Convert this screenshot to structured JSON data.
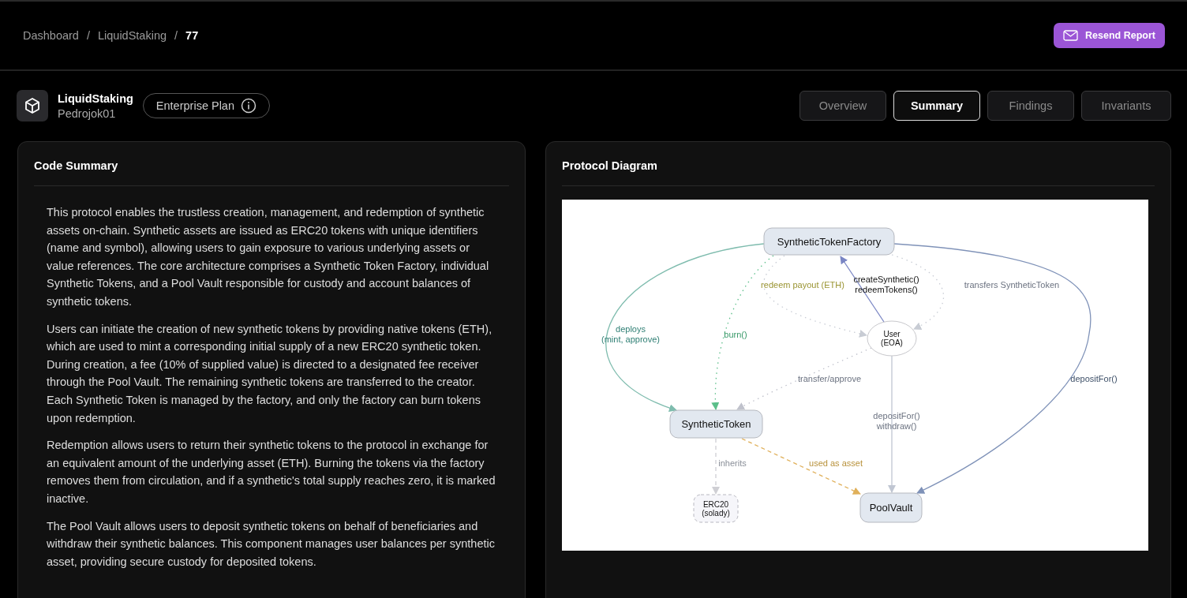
{
  "breadcrumb": [
    {
      "label": "Dashboard",
      "kind": "link"
    },
    {
      "label": "/",
      "kind": "separator"
    },
    {
      "label": "LiquidStaking",
      "kind": "link"
    },
    {
      "label": "/",
      "kind": "separator"
    },
    {
      "label": "77",
      "kind": "current"
    }
  ],
  "resend_button": "Resend Report",
  "project": {
    "name": "LiquidStaking",
    "owner": "Pedrojok01",
    "plan": "Enterprise Plan"
  },
  "tabs": [
    {
      "label": "Overview",
      "selected": false
    },
    {
      "label": "Summary",
      "selected": true
    },
    {
      "label": "Findings",
      "selected": false
    },
    {
      "label": "Invariants",
      "selected": false
    }
  ],
  "code_summary": {
    "title": "Code Summary",
    "paragraphs": [
      "This protocol enables the trustless creation, management, and redemption of synthetic assets on-chain. Synthetic assets are issued as ERC20 tokens with unique identifiers (name and symbol), allowing users to gain exposure to various underlying assets or value references. The core architecture comprises a Synthetic Token Factory, individual Synthetic Tokens, and a Pool Vault responsible for custody and account balances of synthetic tokens.",
      "Users can initiate the creation of new synthetic tokens by providing native tokens (ETH), which are used to mint a corresponding initial supply of a new ERC20 synthetic token. During creation, a fee (10% of supplied value) is directed to a designated fee receiver through the Pool Vault. The remaining synthetic tokens are transferred to the creator. Each Synthetic Token is managed by the factory, and only the factory can burn tokens upon redemption.",
      "Redemption allows users to return their synthetic tokens to the protocol in exchange for an equivalent amount of the underlying asset (ETH). Burning the tokens via the factory removes them from circulation, and if a synthetic's total supply reaches zero, it is marked inactive.",
      "The Pool Vault allows users to deposit synthetic tokens on behalf of beneficiaries and withdraw their synthetic balances. This component manages user balances per synthetic asset, providing secure custody for deposited tokens."
    ]
  },
  "protocol_diagram": {
    "title": "Protocol Diagram",
    "nodes": [
      {
        "label": "SyntheticTokenFactory",
        "kind": "box"
      },
      {
        "label": "User\n(EOA)",
        "kind": "ellipse"
      },
      {
        "label": "SyntheticToken",
        "kind": "box"
      },
      {
        "label": "ERC20\n(solady)",
        "kind": "external"
      },
      {
        "label": "PoolVault",
        "kind": "box"
      }
    ],
    "edges": [
      {
        "label": "deploys\n(mint, approve)",
        "color": "#7fbcae"
      },
      {
        "label": "burn()",
        "color": "#5cbf8a"
      },
      {
        "label": "redeem payout (ETH)",
        "color": "#c8ccd4"
      },
      {
        "label": "createSynthetic()\nredeemTokens()",
        "color": "#7a86c4"
      },
      {
        "label": "transfers SyntheticToken",
        "color": "#c8ccd4"
      },
      {
        "label": "transfer/approve",
        "color": "#c0c2cc"
      },
      {
        "label": "depositFor()\nwithdraw()",
        "color": "#c0c6d2"
      },
      {
        "label": "depositFor()",
        "color": "#7f92b8"
      },
      {
        "label": "inherits",
        "color": "#cfcfd4"
      },
      {
        "label": "used as asset",
        "color": "#e0b05a"
      }
    ]
  }
}
